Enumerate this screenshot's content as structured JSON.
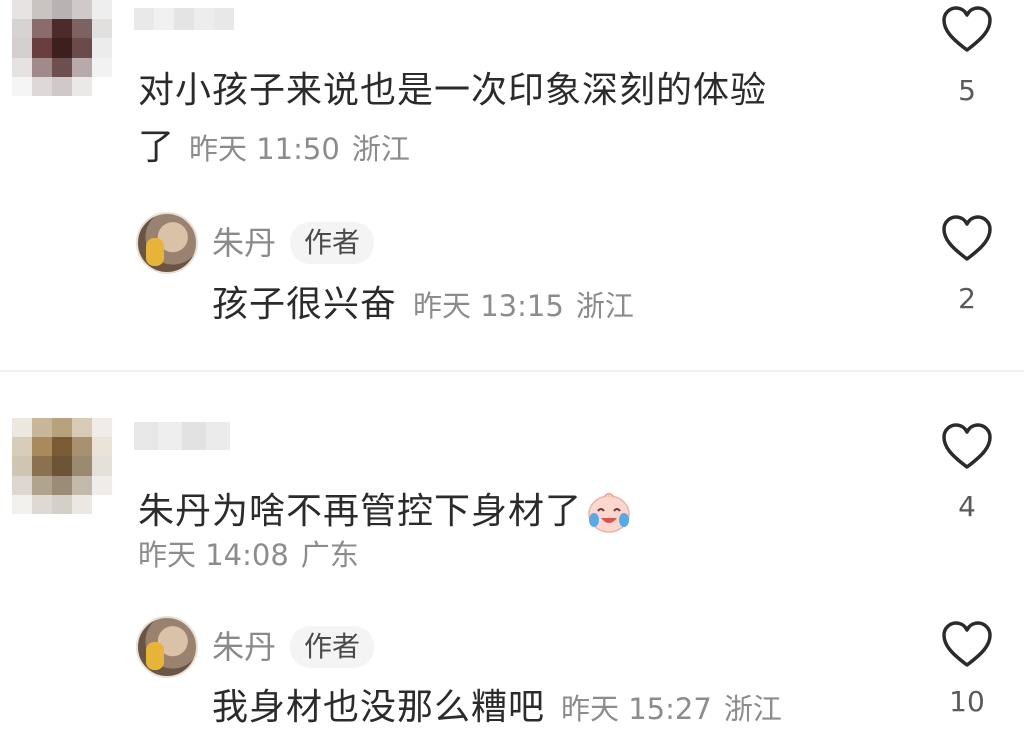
{
  "comments": [
    {
      "text_line1": "对小孩子来说也是一次印象深刻的体验",
      "text_line2": "了",
      "time": "昨天 11:50",
      "location": "浙江",
      "likes": "5",
      "reply": {
        "author": "朱丹",
        "badge": "作者",
        "text": "孩子很兴奋",
        "time": "昨天 13:15",
        "location": "浙江",
        "likes": "2"
      }
    },
    {
      "text_line1": "朱丹为啥不再管控下身材了",
      "time": "昨天 14:08",
      "location": "广东",
      "likes": "4",
      "emoji": "crying-laughing-emoji",
      "reply": {
        "author": "朱丹",
        "badge": "作者",
        "text": "我身材也没那么糟吧",
        "time": "昨天 15:27",
        "location": "浙江",
        "likes": "10"
      }
    }
  ],
  "icons": {
    "like": "heart-outline-icon"
  },
  "colors": {
    "text": "#2b2b2b",
    "meta": "#8c8c8c",
    "badge_bg": "#f4f4f4"
  }
}
